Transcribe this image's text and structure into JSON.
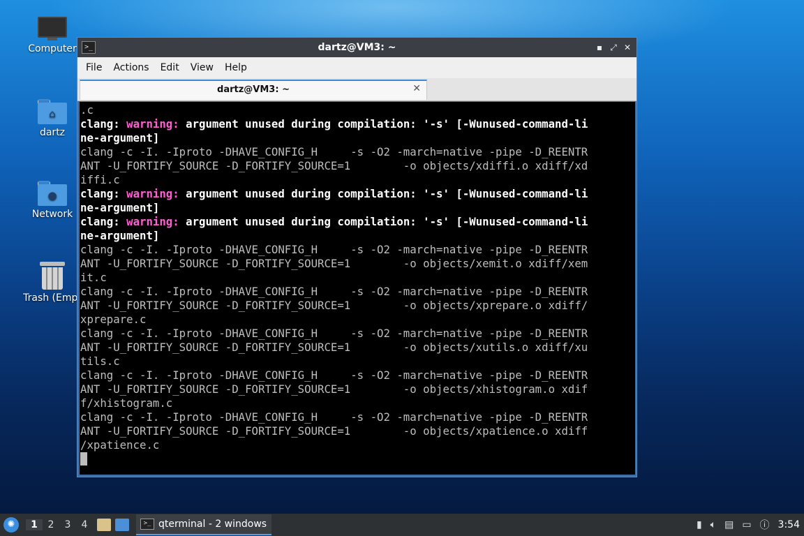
{
  "desktop": {
    "icons": [
      {
        "label": "Computer"
      },
      {
        "label": "dartz"
      },
      {
        "label": "Network"
      },
      {
        "label": "Trash (Empt"
      }
    ]
  },
  "window": {
    "title": "dartz@VM3: ~",
    "controls": {
      "minimize": "▪",
      "maximize": "⤢",
      "close": "✕"
    },
    "menu": [
      "File",
      "Actions",
      "Edit",
      "View",
      "Help"
    ],
    "tab": {
      "label": "dartz@VM3: ~",
      "close": "✕"
    },
    "terminal_lines": [
      [
        {
          "t": ".c"
        }
      ],
      [
        {
          "t": "clang: ",
          "c": "bold"
        },
        {
          "t": "warning: ",
          "c": "warn"
        },
        {
          "t": "argument unused during compilation: '-s' [-Wunused-command-li",
          "c": "bold"
        }
      ],
      [
        {
          "t": "ne-argument]",
          "c": "bold"
        }
      ],
      [
        {
          "t": "clang -c -I. -Iproto -DHAVE_CONFIG_H     -s -O2 -march=native -pipe -D_REENTR"
        }
      ],
      [
        {
          "t": "ANT -U_FORTIFY_SOURCE -D_FORTIFY_SOURCE=1        -o objects/xdiffi.o xdiff/xd"
        }
      ],
      [
        {
          "t": "iffi.c"
        }
      ],
      [
        {
          "t": "clang: ",
          "c": "bold"
        },
        {
          "t": "warning: ",
          "c": "warn"
        },
        {
          "t": "argument unused during compilation: '-s' [-Wunused-command-li",
          "c": "bold"
        }
      ],
      [
        {
          "t": "ne-argument]",
          "c": "bold"
        }
      ],
      [
        {
          "t": "clang: ",
          "c": "bold"
        },
        {
          "t": "warning: ",
          "c": "warn"
        },
        {
          "t": "argument unused during compilation: '-s' [-Wunused-command-li",
          "c": "bold"
        }
      ],
      [
        {
          "t": "ne-argument]",
          "c": "bold"
        }
      ],
      [
        {
          "t": "clang -c -I. -Iproto -DHAVE_CONFIG_H     -s -O2 -march=native -pipe -D_REENTR"
        }
      ],
      [
        {
          "t": "ANT -U_FORTIFY_SOURCE -D_FORTIFY_SOURCE=1        -o objects/xemit.o xdiff/xem"
        }
      ],
      [
        {
          "t": "it.c"
        }
      ],
      [
        {
          "t": "clang -c -I. -Iproto -DHAVE_CONFIG_H     -s -O2 -march=native -pipe -D_REENTR"
        }
      ],
      [
        {
          "t": "ANT -U_FORTIFY_SOURCE -D_FORTIFY_SOURCE=1        -o objects/xprepare.o xdiff/"
        }
      ],
      [
        {
          "t": "xprepare.c"
        }
      ],
      [
        {
          "t": "clang -c -I. -Iproto -DHAVE_CONFIG_H     -s -O2 -march=native -pipe -D_REENTR"
        }
      ],
      [
        {
          "t": "ANT -U_FORTIFY_SOURCE -D_FORTIFY_SOURCE=1        -o objects/xutils.o xdiff/xu"
        }
      ],
      [
        {
          "t": "tils.c"
        }
      ],
      [
        {
          "t": "clang -c -I. -Iproto -DHAVE_CONFIG_H     -s -O2 -march=native -pipe -D_REENTR"
        }
      ],
      [
        {
          "t": "ANT -U_FORTIFY_SOURCE -D_FORTIFY_SOURCE=1        -o objects/xhistogram.o xdif"
        }
      ],
      [
        {
          "t": "f/xhistogram.c"
        }
      ],
      [
        {
          "t": "clang -c -I. -Iproto -DHAVE_CONFIG_H     -s -O2 -march=native -pipe -D_REENTR"
        }
      ],
      [
        {
          "t": "ANT -U_FORTIFY_SOURCE -D_FORTIFY_SOURCE=1        -o objects/xpatience.o xdiff"
        }
      ],
      [
        {
          "t": "/xpatience.c"
        }
      ]
    ],
    "colors": {
      "warning": "#ff5fd2",
      "text": "#bdbdbd",
      "background": "#000000"
    }
  },
  "taskbar": {
    "workspaces": [
      "1",
      "2",
      "3",
      "4"
    ],
    "active_workspace": "1",
    "task_label": "qterminal - 2 windows",
    "clock": "3:54"
  }
}
